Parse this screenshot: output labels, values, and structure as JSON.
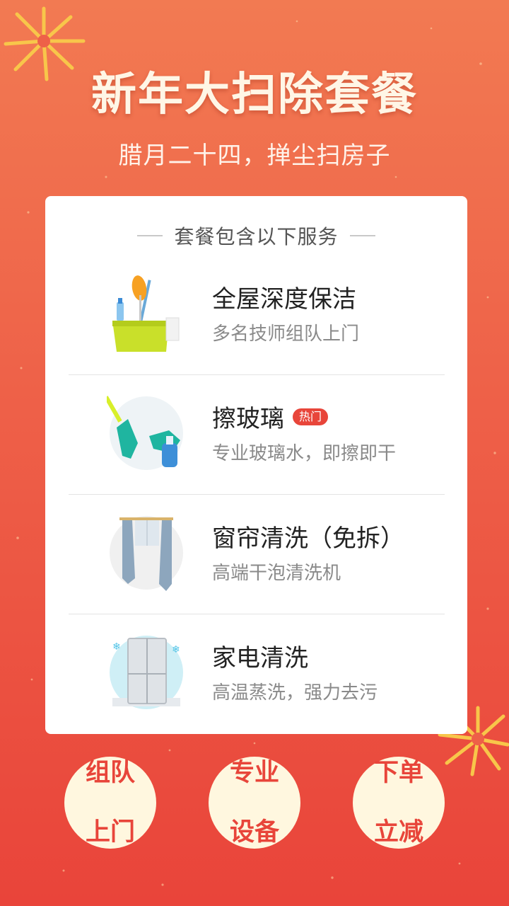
{
  "header": {
    "title": "新年大扫除套餐",
    "subtitle": "腊月二十四，掸尘扫房子"
  },
  "card": {
    "heading": "套餐包含以下服务",
    "services": [
      {
        "name": "全屋深度保洁",
        "desc": "多名技师组队上门",
        "icon": "cleaning-bucket-icon"
      },
      {
        "name": "擦玻璃",
        "badge": "热门",
        "desc": "专业玻璃水，即擦即干",
        "icon": "glass-wiping-icon"
      },
      {
        "name": "窗帘清洗（免拆）",
        "desc": "高端干泡清洗机",
        "icon": "curtain-icon"
      },
      {
        "name": "家电清洗",
        "desc": "高温蒸洗，强力去污",
        "icon": "refrigerator-icon"
      }
    ]
  },
  "features": [
    {
      "line1": "组队",
      "line2": "上门"
    },
    {
      "line1": "专业",
      "line2": "设备"
    },
    {
      "line1": "下单",
      "line2": "立减"
    }
  ],
  "colors": {
    "background_top": "#f27a52",
    "background_bottom": "#e9443a",
    "accent_red": "#e8453a",
    "circle_fill": "#fff7df",
    "firework_gold": "#f8c64a"
  }
}
